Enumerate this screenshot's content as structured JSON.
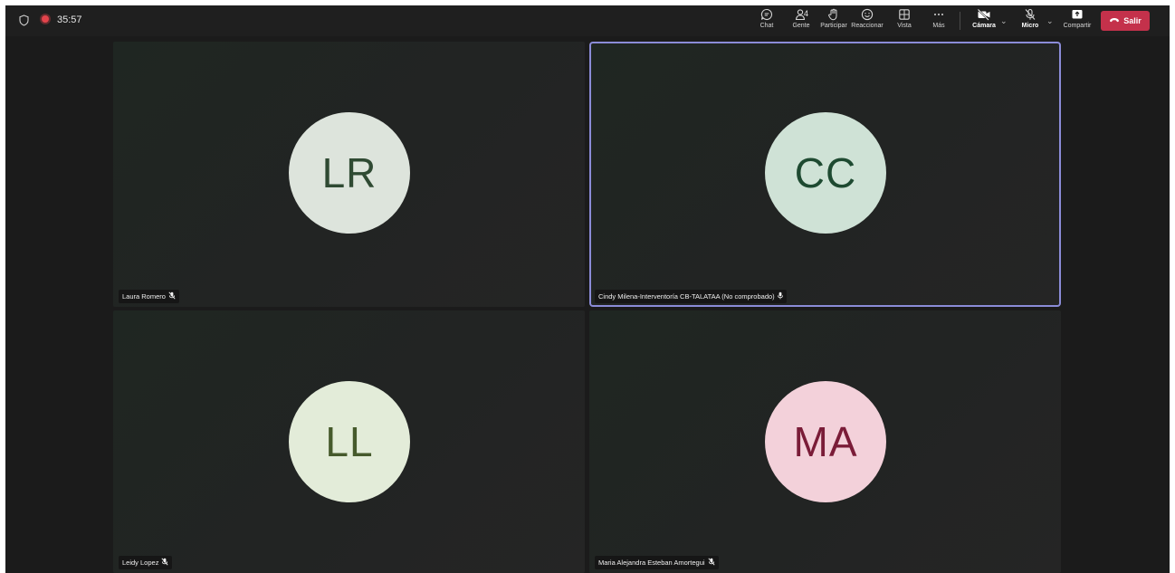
{
  "toolbar": {
    "timer": "35:57",
    "people_count": "4",
    "buttons": {
      "chat": "Chat",
      "people": "Gente",
      "raise_hand": "Participar",
      "react": "Reaccionar",
      "view": "Vista",
      "more": "Más",
      "camera": "Cámara",
      "mic": "Micro",
      "share": "Compartir",
      "leave": "Salir"
    },
    "icons": {
      "shield": "shield-icon",
      "recording": "recording-icon",
      "chat": "chat-icon",
      "people": "people-icon",
      "raise_hand": "hand-icon",
      "react": "smiley-icon",
      "view": "grid-icon",
      "more": "ellipsis-icon",
      "camera": "camera-off-icon",
      "mic": "mic-off-icon",
      "share": "share-icon",
      "leave": "phone-hangup-icon"
    }
  },
  "participants": [
    {
      "initials": "LR",
      "name": "Laura Romero",
      "muted": true,
      "active": false,
      "avatar_bg": "#dde4dc",
      "avatar_fg": "#2f4a33"
    },
    {
      "initials": "CC",
      "name": "Cindy Milena-Interventoría CB-TALATAA (No comprobado)",
      "muted": false,
      "active": true,
      "avatar_bg": "#cfe2d6",
      "avatar_fg": "#1e4a31"
    },
    {
      "initials": "LL",
      "name": "Leidy Lopez",
      "muted": true,
      "active": false,
      "avatar_bg": "#e3ecd9",
      "avatar_fg": "#465a2c"
    },
    {
      "initials": "MA",
      "name": "Maria Alejandra Esteban Amortegui",
      "muted": true,
      "active": false,
      "avatar_bg": "#f3d1da",
      "avatar_fg": "#7a1c38"
    }
  ],
  "colors": {
    "leave": "#c4314b",
    "active_border": "#8b8cd8",
    "background": "#1b1b1b"
  }
}
